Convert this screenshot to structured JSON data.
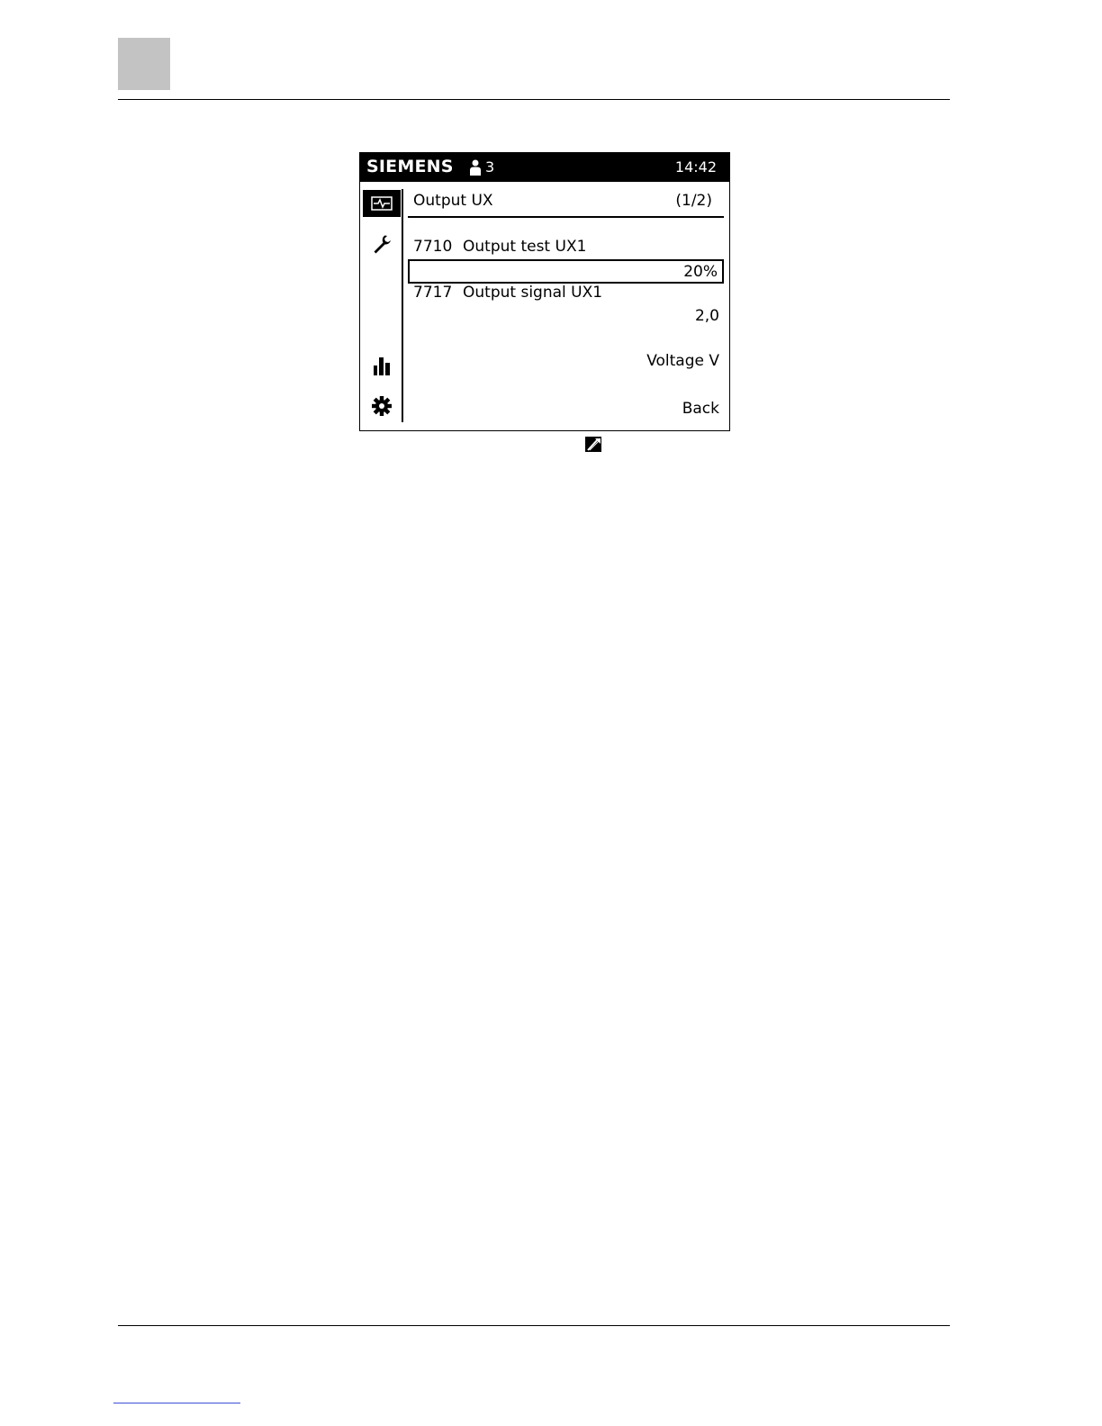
{
  "screen": {
    "brand": "SIEMENS",
    "user_level": "3",
    "time": "14:42",
    "title": "Output UX",
    "page": "(1/2)",
    "params": [
      {
        "number": "7710",
        "label": "Output test UX1",
        "value": "20%"
      },
      {
        "number": "7717",
        "label": "Output signal UX1",
        "value": "2,0"
      }
    ],
    "unit_label": "Voltage V",
    "back_label": "Back",
    "sidebar_icons": [
      "pulse-icon",
      "wrench-icon",
      "bar-chart-icon",
      "gear-icon"
    ]
  }
}
